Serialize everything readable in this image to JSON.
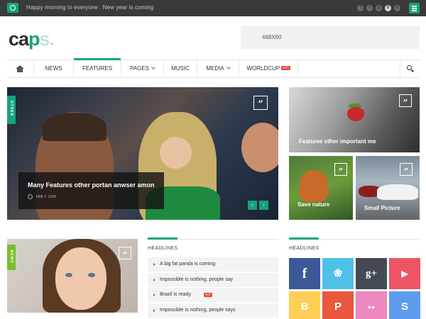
{
  "topbar": {
    "ticker": "Happy morning to everyone . New year is coming",
    "social_icons": [
      "facebook-icon",
      "twitter-icon",
      "google-plus-icon",
      "skype-icon",
      "dribbble-icon"
    ]
  },
  "header": {
    "logo_part1": "ca",
    "logo_part2": "p",
    "logo_part3": "s.",
    "ad_label": "468X60"
  },
  "nav": {
    "items": [
      "NEWS",
      "FEATURES",
      "PAGES",
      "MUSIC",
      "MEDIA",
      "WORLDCUP"
    ],
    "active_item": "FEATURES",
    "hot_badge": "HOT"
  },
  "hero": {
    "tag": "OTHER",
    "title": "Many Features other portan anwser amon",
    "date": "FEB 7, 2104",
    "quote_glyph": "”",
    "prev_glyph": "‹",
    "next_glyph": "›"
  },
  "tiles": {
    "features_caption": "Features other important me",
    "nature_caption": "Save nature",
    "small_caption": "Small Picture"
  },
  "news_block": {
    "tag": "NEWS"
  },
  "headlines": {
    "title": "HEADLINES",
    "items": [
      {
        "text": "A big fat panda is coming",
        "hot": false
      },
      {
        "text": "Impossible is nothing, people say",
        "hot": false
      },
      {
        "text": "Brazil is ready",
        "hot": true
      },
      {
        "text": "Impossible is nothing, people says",
        "hot": false
      }
    ]
  },
  "social_section": {
    "title": "HEADLINES",
    "buttons": [
      {
        "name": "facebook",
        "glyph": "f",
        "color": "#3b5998"
      },
      {
        "name": "twitter",
        "glyph": "❀",
        "color": "#4fc1e9"
      },
      {
        "name": "google-plus",
        "glyph": "g+",
        "color": "#434a54"
      },
      {
        "name": "youtube",
        "glyph": "▶",
        "color": "#ed5565"
      },
      {
        "name": "blogger",
        "glyph": "B",
        "color": "#ffce54"
      },
      {
        "name": "pinterest",
        "glyph": "P",
        "color": "#e9573f"
      },
      {
        "name": "flickr",
        "glyph": "●●",
        "color": "#ec87c0"
      },
      {
        "name": "skype",
        "glyph": "S",
        "color": "#5d9cec"
      }
    ]
  },
  "colors": {
    "accent": "#16a37e",
    "topbar": "#3a3a3a",
    "hot": "#e74c3c"
  }
}
